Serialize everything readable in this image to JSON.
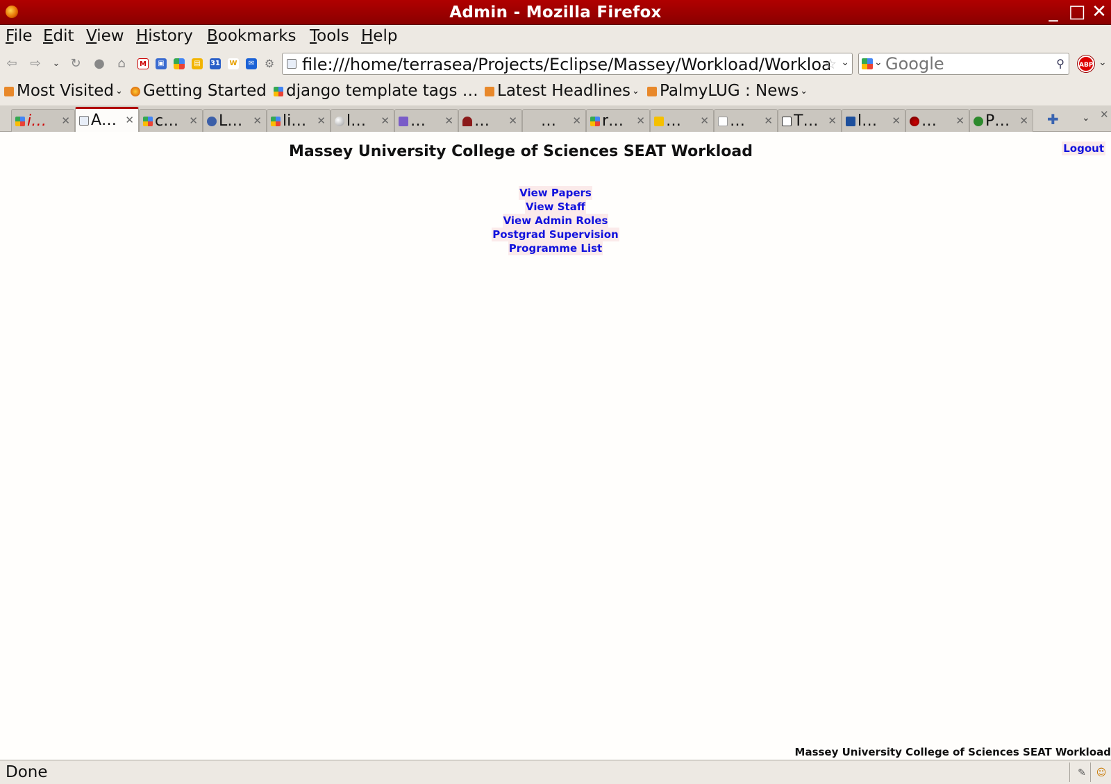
{
  "window": {
    "title": "Admin - Mozilla Firefox",
    "minimize_glyph": "_",
    "maximize_glyph": "□",
    "close_glyph": "✕"
  },
  "menu": [
    "File",
    "Edit",
    "View",
    "History",
    "Bookmarks",
    "Tools",
    "Help"
  ],
  "navigation": {
    "url": "file:///home/terrasea/Projects/Eclipse/Massey/Workload/Workload",
    "search_placeholder": "Google",
    "abp_label": "ABP"
  },
  "bookmarks": [
    {
      "label": "Most Visited",
      "icon": "rss-folder-icon",
      "dropdown": true
    },
    {
      "label": "Getting Started",
      "icon": "firefox-icon",
      "dropdown": false
    },
    {
      "label": "django template tags …",
      "icon": "google-icon",
      "dropdown": false
    },
    {
      "label": "Latest Headlines",
      "icon": "rss-icon",
      "dropdown": true
    },
    {
      "label": "PalmyLUG : News",
      "icon": "rss-icon",
      "dropdown": true
    }
  ],
  "tabs": [
    {
      "label": "i…",
      "icon": "google-icon",
      "active": false
    },
    {
      "label": "A…",
      "icon": "page-icon",
      "active": true
    },
    {
      "label": "c…",
      "icon": "google-icon",
      "active": false
    },
    {
      "label": "L…",
      "icon": "person-icon",
      "active": false
    },
    {
      "label": "li…",
      "icon": "google-icon",
      "active": false
    },
    {
      "label": "l…",
      "icon": "moon-icon",
      "active": false
    },
    {
      "label": "…",
      "icon": "purple-icon",
      "active": false
    },
    {
      "label": "…",
      "icon": "wine-icon",
      "active": false
    },
    {
      "label": "…",
      "icon": "blank-icon",
      "active": false
    },
    {
      "label": "r…",
      "icon": "google-icon",
      "active": false
    },
    {
      "label": "…",
      "icon": "check-icon",
      "active": false
    },
    {
      "label": "…",
      "icon": "wikipedia-icon",
      "active": false
    },
    {
      "label": "T…",
      "icon": "home-icon",
      "active": false
    },
    {
      "label": "l…",
      "icon": "shield-icon",
      "active": false
    },
    {
      "label": "…",
      "icon": "red-ball-icon",
      "active": false
    },
    {
      "label": "P…",
      "icon": "clover-icon",
      "active": false
    }
  ],
  "page": {
    "title": "Massey University College of Sciences SEAT Workload",
    "logout": "Logout",
    "links": [
      "View Papers",
      "View Staff",
      "View Admin Roles",
      "Postgrad Supervision",
      "Programme List"
    ],
    "footer": "Massey University College of Sciences SEAT Workload"
  },
  "status": {
    "text": "Done"
  },
  "colors": {
    "titlebar": "#9c0000",
    "link": "#1212dd",
    "link_bg": "#fbeaea",
    "page_bg": "#fffefc"
  }
}
